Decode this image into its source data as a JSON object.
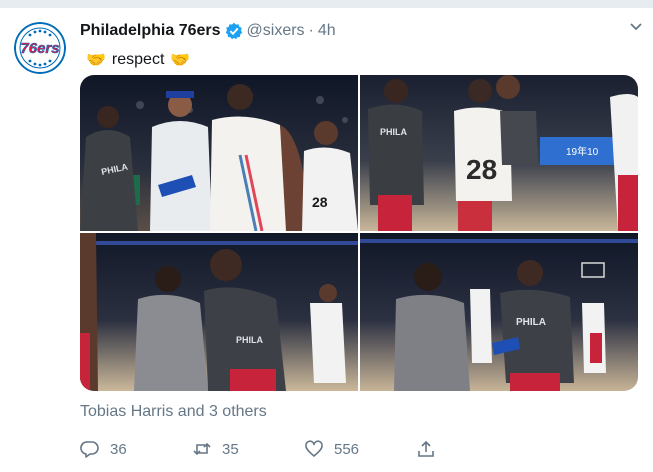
{
  "tweet": {
    "author_name": "Philadelphia 76ers",
    "handle": "@sixers",
    "separator": "·",
    "time": "4h",
    "text": "respect",
    "emoji_left": "🤝",
    "emoji_right": "🤝",
    "tagged_users": "Tobias Harris and 3 others",
    "avatar_logo_text": "76ers"
  },
  "photos": [
    {
      "jersey_text": "PHILA",
      "number": "28"
    },
    {
      "jersey_text": "PHILA",
      "number": "28",
      "sign_text": "19年10"
    },
    {
      "jersey_text": "PHILA",
      "number": ""
    },
    {
      "jersey_text": "PHILA",
      "number": ""
    }
  ],
  "actions": {
    "replies": "36",
    "retweets": "35",
    "likes": "556"
  },
  "colors": {
    "brand_blue": "#006bb6",
    "brand_red": "#ed174c",
    "verified_blue": "#1da1f2",
    "muted_text": "#657786"
  },
  "icons": [
    "chevron-down-icon",
    "verified-badge-icon",
    "reply-icon",
    "retweet-icon",
    "like-icon",
    "share-icon"
  ]
}
